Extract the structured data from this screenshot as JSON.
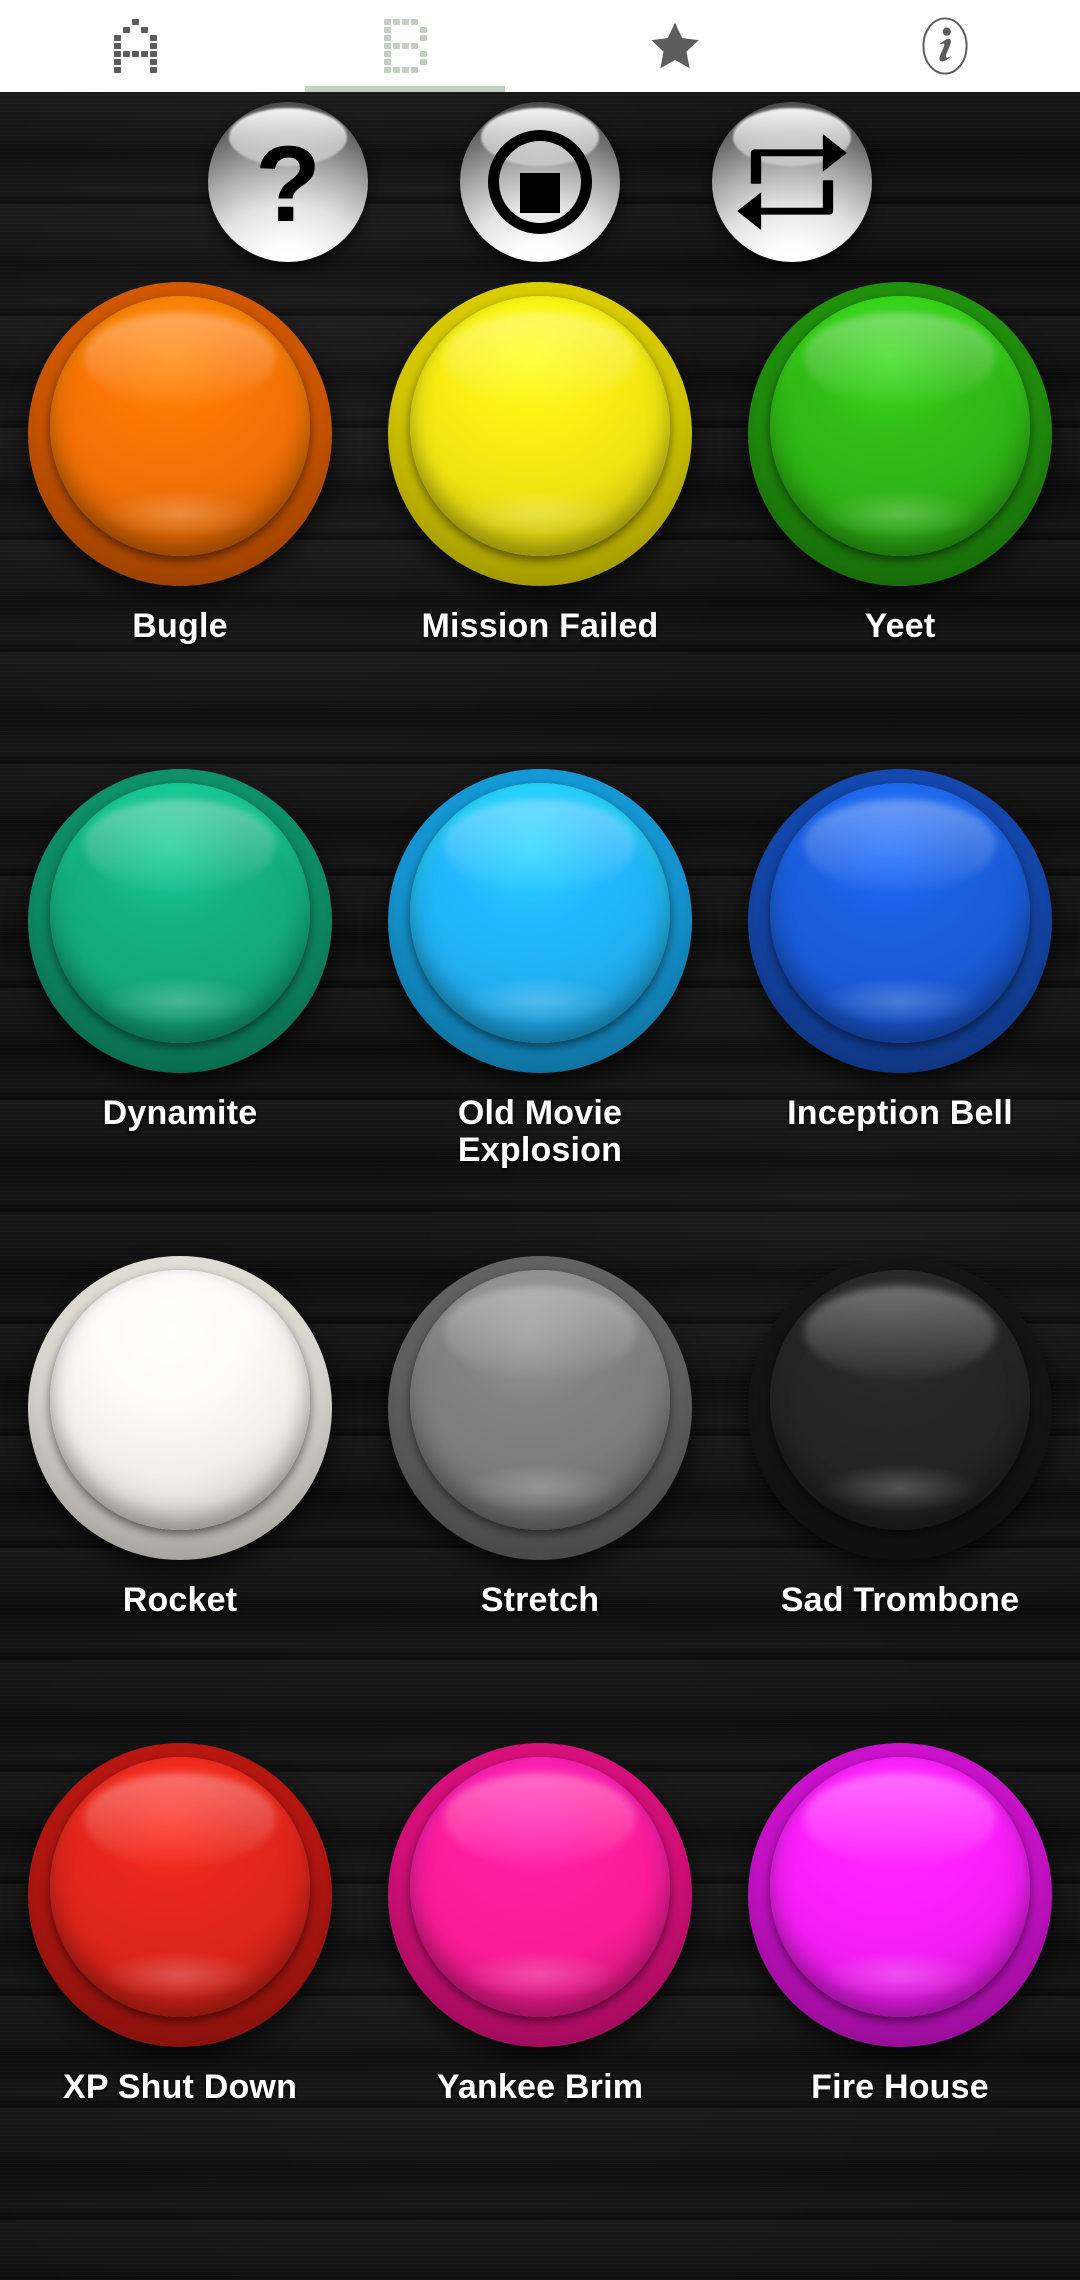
{
  "tabs": [
    {
      "id": "tab-a",
      "icon": "pixel-letter-a-icon",
      "label": "A",
      "selected": false
    },
    {
      "id": "tab-b",
      "icon": "pixel-letter-b-icon",
      "label": "B",
      "selected": true
    },
    {
      "id": "tab-favorites",
      "icon": "star-icon",
      "label": "Star",
      "selected": false
    },
    {
      "id": "tab-info",
      "icon": "info-icon",
      "label": "Info",
      "selected": false
    }
  ],
  "transport": [
    {
      "id": "random-button",
      "icon": "question-mark-icon",
      "label": "?"
    },
    {
      "id": "stop-button",
      "icon": "stop-icon",
      "label": "Stop"
    },
    {
      "id": "loop-button",
      "icon": "repeat-icon",
      "label": "Repeat"
    }
  ],
  "sounds": [
    {
      "label": "Bugle",
      "color": "#ea6a00",
      "base": "#c85400",
      "cap": "#ef6f06"
    },
    {
      "label": "Mission Failed",
      "color": "#ece00f",
      "base": "#d0c400",
      "cap": "#efe312"
    },
    {
      "label": "Yeet",
      "color": "#2ca914",
      "base": "#1f8a0c",
      "cap": "#2fb416"
    },
    {
      "label": "Dynamite",
      "color": "#14a379",
      "base": "#0d8a64",
      "cap": "#14a97d"
    },
    {
      "label": "Old Movie Explosion",
      "color": "#1ea8e8",
      "base": "#1492cd",
      "cap": "#21b0f2"
    },
    {
      "label": "Inception Bell",
      "color": "#1a56c8",
      "base": "#1345a6",
      "cap": "#1a5ad6"
    },
    {
      "label": "Rocket",
      "color": "#eceae1",
      "base": "#d6d4cb",
      "cap": "#f1efe7"
    },
    {
      "label": "Stretch",
      "color": "#767676",
      "base": "#5e5e5e",
      "cap": "#7c7c7c"
    },
    {
      "label": "Sad Trombone",
      "color": "#1f1f1f",
      "base": "#141414",
      "cap": "#242424"
    },
    {
      "label": "XP Shut Down",
      "color": "#d52118",
      "base": "#b01610",
      "cap": "#dc251b"
    },
    {
      "label": "Yankee Brim",
      "color": "#f2188c",
      "base": "#cf0f76",
      "cap": "#f81c95"
    },
    {
      "label": "Fire House",
      "color": "#e81ae8",
      "base": "#c311c3",
      "cap": "#f31ef3"
    }
  ],
  "theme": {
    "tabbar_background": "#ffffff",
    "tab_selected_color": "#c3cfc2",
    "tab_unselected_color": "#5c5c5c",
    "board_background": "#0d0d0d",
    "label_color": "#ffffff"
  }
}
